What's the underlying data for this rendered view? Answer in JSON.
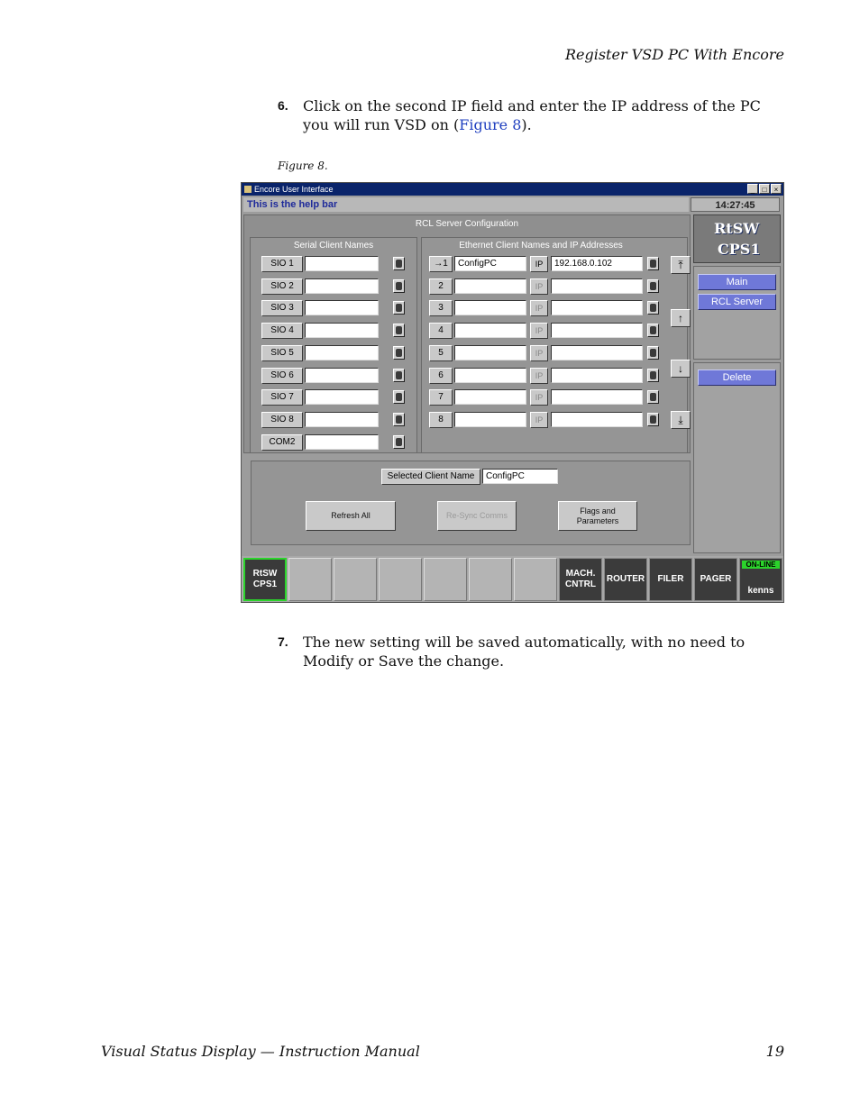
{
  "header": {
    "running_title": "Register VSD PC With Encore"
  },
  "step6": {
    "number": "6.",
    "text_before": "Click on the second IP field and enter the IP address of the PC you will run VSD on (",
    "link": "Figure 8",
    "text_after": ")."
  },
  "figure_caption": "Figure 8.",
  "step7": {
    "number": "7.",
    "text": "The new setting will be saved automatically, with no need to Modify or Save the change."
  },
  "footer": {
    "left": "Visual Status Display  —  Instruction Manual",
    "page": "19"
  },
  "app": {
    "window_title": "Encore User Interface",
    "window_buttons": [
      "_",
      "□",
      "×"
    ],
    "help_bar": "This is the help bar",
    "clock": "14:27:45",
    "main_title": "RCL Server Configuration",
    "serial_title": "Serial Client Names",
    "ethernet_title": "Ethernet Client Names and IP Addresses",
    "serial_clients": [
      {
        "label": "SIO 1",
        "value": ""
      },
      {
        "label": "SIO 2",
        "value": ""
      },
      {
        "label": "SIO 3",
        "value": ""
      },
      {
        "label": "SIO 4",
        "value": ""
      },
      {
        "label": "SIO 5",
        "value": ""
      },
      {
        "label": "SIO 6",
        "value": ""
      },
      {
        "label": "SIO 7",
        "value": ""
      },
      {
        "label": "SIO 8",
        "value": ""
      },
      {
        "label": "COM2",
        "value": ""
      }
    ],
    "ethernet_clients": [
      {
        "label": "→1",
        "name": "ConfigPC",
        "ip_label": "IP",
        "ip": "192.168.0.102"
      },
      {
        "label": "2",
        "name": "",
        "ip_label": "IP",
        "ip": ""
      },
      {
        "label": "3",
        "name": "",
        "ip_label": "IP",
        "ip": ""
      },
      {
        "label": "4",
        "name": "",
        "ip_label": "IP",
        "ip": ""
      },
      {
        "label": "5",
        "name": "",
        "ip_label": "IP",
        "ip": ""
      },
      {
        "label": "6",
        "name": "",
        "ip_label": "IP",
        "ip": ""
      },
      {
        "label": "7",
        "name": "",
        "ip_label": "IP",
        "ip": ""
      },
      {
        "label": "8",
        "name": "",
        "ip_label": "IP",
        "ip": ""
      }
    ],
    "scroll_icons": [
      "⤒",
      "↑",
      "↓",
      "⤓"
    ],
    "selected_client_label": "Selected Client Name",
    "selected_client_value": "ConfigPC",
    "buttons": {
      "refresh": "Refresh All",
      "resync": "Re-Sync Comms",
      "flags": "Flags and Parameters"
    },
    "logo": {
      "line1": "RtSW",
      "line2": "CPS1"
    },
    "nav": {
      "main": "Main",
      "rcl_server": "RCL Server",
      "delete": "Delete"
    },
    "bottom_tabs": {
      "first_line1": "RtSW",
      "first_line2": "CPS1",
      "mach": "MACH. CNTRL",
      "router": "ROUTER",
      "filer": "FILER",
      "pager": "PAGER",
      "online": "ON-LINE",
      "user": "kenns"
    }
  }
}
